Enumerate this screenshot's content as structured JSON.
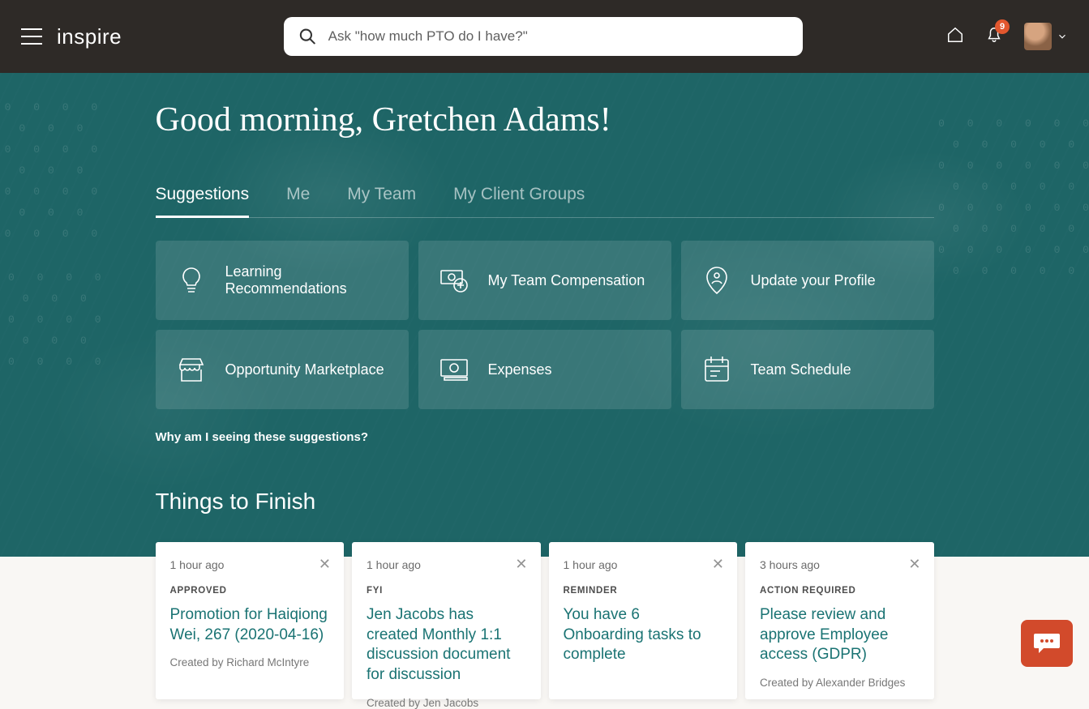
{
  "header": {
    "logo": "inspire",
    "search_placeholder": "Ask \"how much PTO do I have?\"",
    "notification_count": "9"
  },
  "greeting": "Good morning, Gretchen Adams!",
  "tabs": [
    {
      "label": "Suggestions",
      "active": true
    },
    {
      "label": "Me"
    },
    {
      "label": "My Team"
    },
    {
      "label": "My Client Groups"
    }
  ],
  "tiles": [
    {
      "label": "Learning Recommendations",
      "icon": "lightbulb"
    },
    {
      "label": "My Team Compensation",
      "icon": "compensation"
    },
    {
      "label": "Update your Profile",
      "icon": "profile-pin"
    },
    {
      "label": "Opportunity Marketplace",
      "icon": "storefront"
    },
    {
      "label": "Expenses",
      "icon": "money"
    },
    {
      "label": "Team Schedule",
      "icon": "schedule"
    }
  ],
  "why_link": "Why am I seeing these suggestions?",
  "section_title": "Things to Finish",
  "cards": [
    {
      "time": "1 hour ago",
      "category": "APPROVED",
      "title": "Promotion for Haiqiong Wei, 267 (2020-04-16)",
      "author": "Created by Richard McIntyre"
    },
    {
      "time": "1 hour ago",
      "category": "FYI",
      "title": "Jen Jacobs has created Monthly 1:1 discussion document for discussion",
      "author": "Created by Jen Jacobs"
    },
    {
      "time": "1 hour ago",
      "category": "REMINDER",
      "title": "You have 6 Onboarding tasks to complete",
      "author": ""
    },
    {
      "time": "3 hours ago",
      "category": "ACTION REQUIRED",
      "title": "Please review and approve Employee access (GDPR)",
      "author": "Created by Alexander Bridges"
    }
  ]
}
